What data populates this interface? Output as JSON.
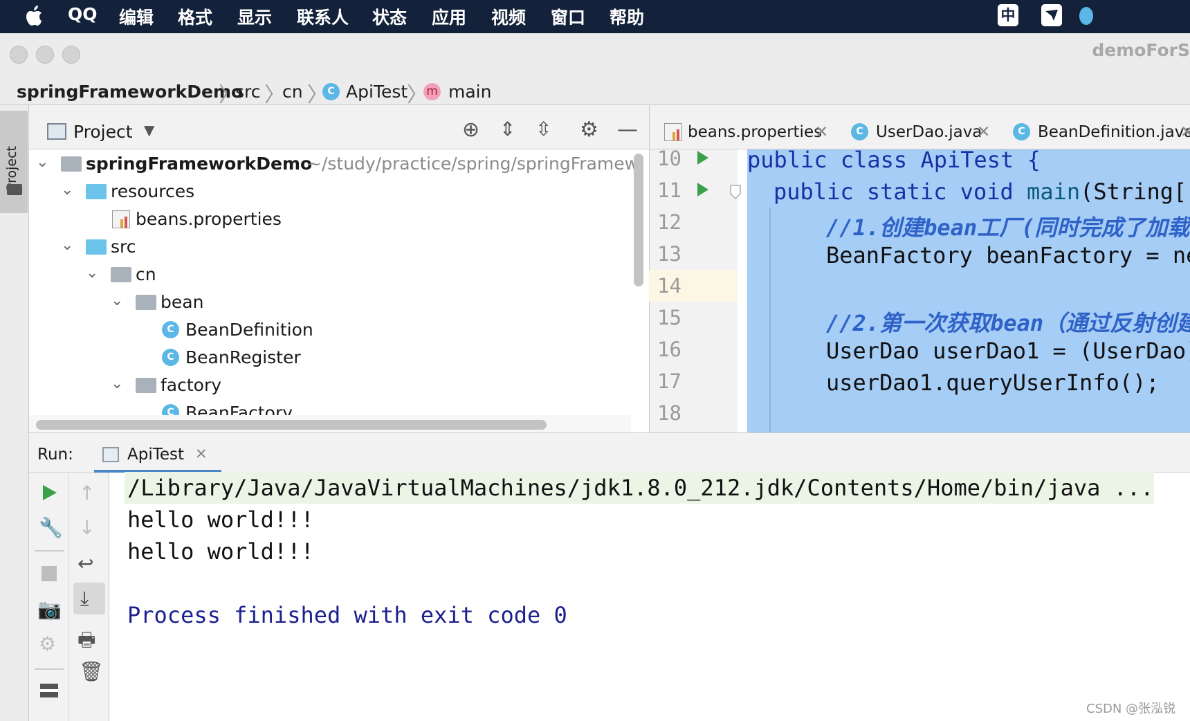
{
  "menubar": {
    "apple": "",
    "items": [
      "QQ",
      "编辑",
      "格式",
      "显示",
      "联系人",
      "状态",
      "应用",
      "视频",
      "窗口",
      "帮助"
    ],
    "input_method": "中"
  },
  "window": {
    "title": "demoForS"
  },
  "breadcrumb": {
    "project": "springFrameworkDemo",
    "src": "src",
    "pkg": "cn",
    "class": "ApiTest",
    "method_icon": "m",
    "method": "main"
  },
  "project_panel": {
    "title": "Project",
    "stripe_label": "Project",
    "tree": {
      "root": "springFrameworkDemo",
      "root_path": "~/study/practice/spring/springFramew",
      "resources": "resources",
      "beans_properties": "beans.properties",
      "src": "src",
      "cn": "cn",
      "bean": "bean",
      "bean_definition": "BeanDefinition",
      "bean_register": "BeanRegister",
      "factory": "factory",
      "bean_factory": "BeanFactory"
    }
  },
  "editor": {
    "tabs": [
      "beans.properties",
      "UserDao.java",
      "BeanDefinition.java"
    ],
    "line_numbers": [
      "10",
      "11",
      "12",
      "13",
      "14",
      "15",
      "16",
      "17",
      "18"
    ],
    "lines": {
      "l10": "public class ApiTest {",
      "l11a": "public static void ",
      "l11b": "main",
      "l11c": "(String[]",
      "l12": "//1.创建bean工厂(同时完成了加载",
      "l13": "BeanFactory beanFactory = ne",
      "l15": "//2.第一次获取bean（通过反射创建",
      "l16": "UserDao userDao1 = (UserDao)",
      "l17": "userDao1.queryUserInfo();"
    }
  },
  "run": {
    "label": "Run:",
    "tab": "ApiTest",
    "console": [
      "/Library/Java/JavaVirtualMachines/jdk1.8.0_212.jdk/Contents/Home/bin/java ...",
      "hello world!!!",
      "hello world!!!",
      "",
      "Process finished with exit code 0"
    ]
  },
  "watermark": "CSDN @张泓锐",
  "colors": {
    "menubar": "#13213a",
    "selection": "#a6cdf6",
    "keyword": "#1a2fa5",
    "comment": "#2f62c7",
    "exit_text": "#1b1f8f",
    "run_green": "#3aa14a"
  }
}
